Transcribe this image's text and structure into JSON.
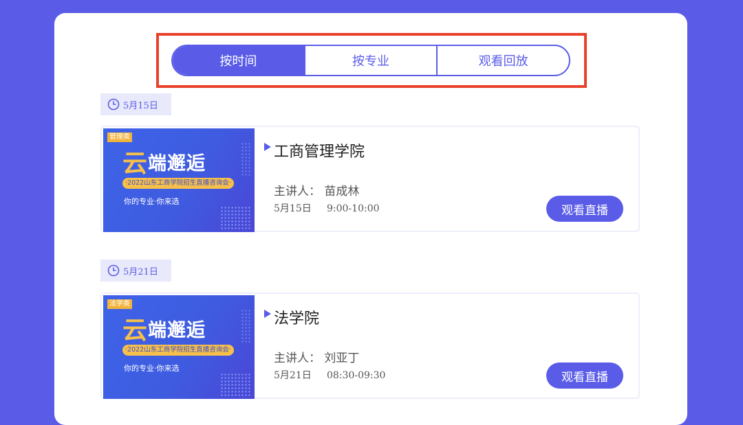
{
  "tabs": [
    {
      "label": "按时间",
      "active": true
    },
    {
      "label": "按专业",
      "active": false
    },
    {
      "label": "观看回放",
      "active": false
    }
  ],
  "sessions": [
    {
      "date_tag": "5月15日",
      "banner": {
        "category": "管理类",
        "headline_first": "云",
        "headline_rest": "端邂逅",
        "subtitle": "·2022山东工商学院招生直播咨询会·",
        "slogan": "你的专业·你来选"
      },
      "title": "工商管理学院",
      "speaker": "主讲人：  苗成林",
      "date": "5月15日",
      "time": "9:00-10:00",
      "button": "观看直播"
    },
    {
      "date_tag": "5月21日",
      "banner": {
        "category": "法学类",
        "headline_first": "云",
        "headline_rest": "端邂逅",
        "subtitle": "·2022山东工商学院招生直播咨询会·",
        "slogan": "你的专业·你来选"
      },
      "title": "法学院",
      "speaker": "主讲人：  刘亚丁",
      "date": "5月21日",
      "time": "08:30-09:30",
      "button": "观看直播"
    }
  ],
  "colors": {
    "accent": "#5a5ce8",
    "highlight": "#e8412b",
    "badge": "#f2b33b"
  }
}
